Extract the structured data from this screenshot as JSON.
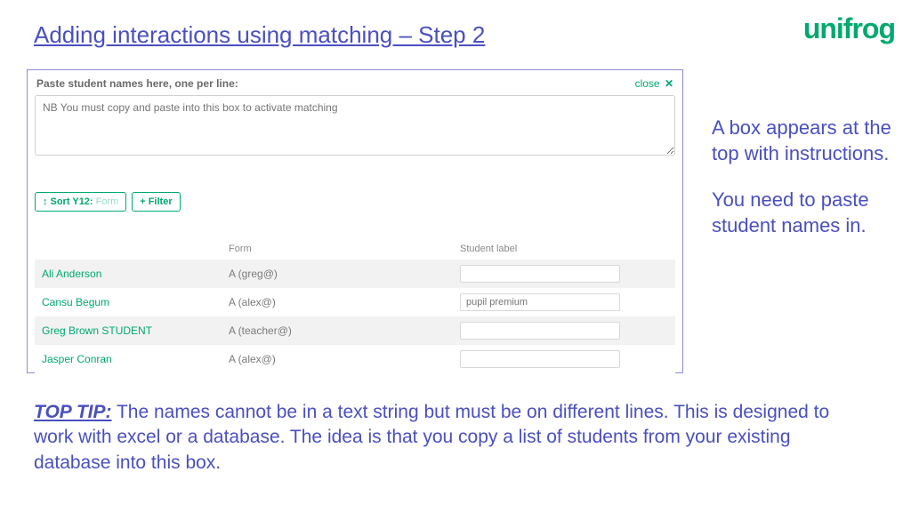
{
  "title": "Adding interactions using matching – Step 2",
  "logo": "unifrog",
  "panel": {
    "paste_instruction": "Paste student names here, one per line:",
    "close_label": "close",
    "textarea_placeholder": "NB You must copy and paste into this box to activate matching",
    "sort_arrow": "↕",
    "sort_strong": "Sort Y12:",
    "sort_light": "Form",
    "filter_plus": "+",
    "filter_label": "Filter",
    "headers": {
      "form": "Form",
      "label": "Student label"
    },
    "rows": [
      {
        "name": "Ali Anderson",
        "form": "A (greg@)",
        "label": ""
      },
      {
        "name": "Cansu Begum",
        "form": "A (alex@)",
        "label": "pupil premium"
      },
      {
        "name": "Greg Brown STUDENT",
        "form": "A (teacher@)",
        "label": ""
      },
      {
        "name": "Jasper Conran",
        "form": "A (alex@)",
        "label": ""
      }
    ]
  },
  "side": {
    "p1": "A box appears at the top with instructions.",
    "p2": "You need to paste student names in."
  },
  "tip": {
    "lead": "TOP TIP:",
    "body": " The names cannot be in a text string but must be on different lines. This is designed to work with excel or a database. The idea is that you copy a list of students from your existing database into this box."
  }
}
